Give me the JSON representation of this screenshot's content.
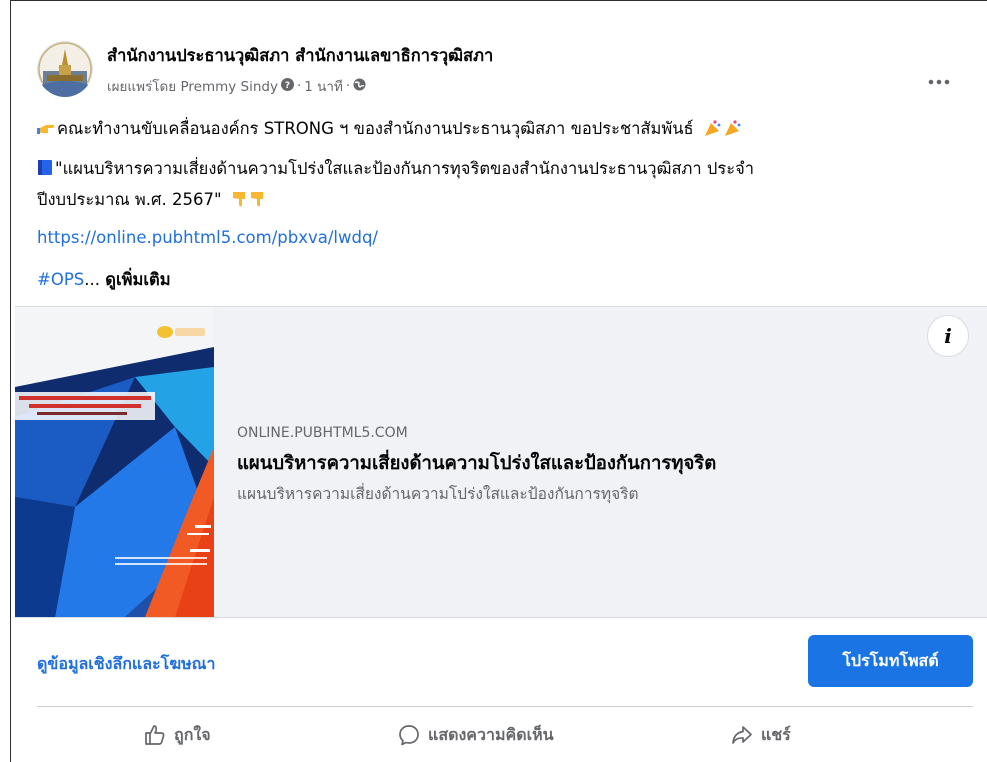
{
  "post": {
    "page_name": "สำนักงานประธานวุฒิสภา สำนักงานเลขาธิการวุฒิสภา",
    "meta": {
      "published_by": "เผยแพร่โดย Premmy Sindy",
      "separator": "·",
      "time": "1 นาที",
      "separator2": "·"
    },
    "more_label": "•••",
    "text": {
      "line1": "คณะทำงานขับเคลื่อนองค์กร STRONG ฯ ของสำนักงานประธานวุฒิสภา ขอประชาสัมพันธ์",
      "line2": "\"แผนบริหารความเสี่ยงด้านความโปร่งใสและป้องกันการทุจริตของสำนักงานประธานวุฒิสภา ประจำ",
      "line3": "ปีงบประมาณ พ.ศ. 2567\"",
      "link": "https://online.pubhtml5.com/pbxva/lwdq/",
      "hashtag": "#OPS",
      "ellipsis": "...",
      "see_more": "ดูเพิ่มเติม"
    },
    "icons": {
      "line1": "pointing-right-hand-icon",
      "line1_end": "party-popper-icon",
      "line2": "blue-book-icon",
      "line3_end": "pointing-down-hand-icon",
      "verified": "question-badge-icon",
      "audience": "globe-icon"
    }
  },
  "preview": {
    "domain": "ONLINE.PUBHTML5.COM",
    "title": "แผนบริหารความเสี่ยงด้านความโปร่งใสและป้องกันการทุจริต",
    "description": "แผนบริหารความเสี่ยงด้านความโปร่งใสและป้องกันการทุจริต",
    "info_label": "i"
  },
  "footer": {
    "insights_link": "ดูข้อมูลเชิงลึกและโฆษณา",
    "promote_button": "โปรโมทโพสต์",
    "actions": {
      "like": "ถูกใจ",
      "comment": "แสดงความคิดเห็น",
      "share": "แชร์"
    }
  },
  "colors": {
    "link": "#216fdb",
    "promote": "#1b74e4",
    "muted": "#65676b",
    "preview_bg": "#f0f2f5"
  }
}
